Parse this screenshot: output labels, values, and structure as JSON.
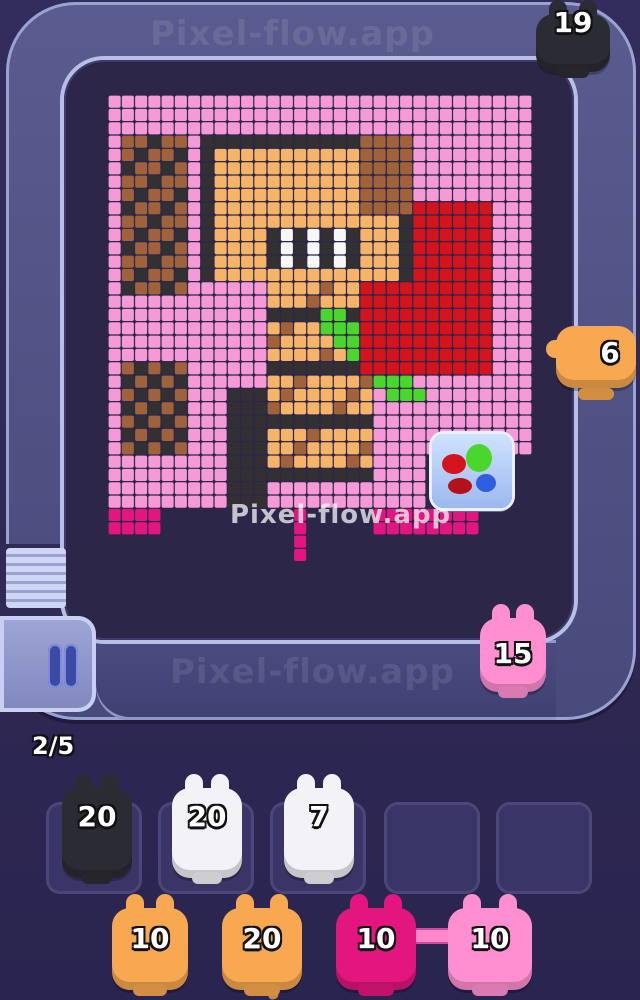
{
  "watermark": "Pixel-flow.app",
  "progress": "2/5",
  "conveyor_pigs": [
    {
      "id": "top-right",
      "count": "19",
      "color": "#2b2b33"
    },
    {
      "id": "right",
      "count": "6",
      "color": "#f7a850"
    },
    {
      "id": "bottom-right",
      "count": "15",
      "color": "#ff8fd0"
    }
  ],
  "slot_pigs": [
    {
      "count": "20",
      "color": "#2b2b33"
    },
    {
      "count": "20",
      "color": "#f2f2f7"
    },
    {
      "count": "7",
      "color": "#f2f2f7"
    }
  ],
  "queue_pigs": [
    {
      "count": "10",
      "color": "#f7a850"
    },
    {
      "count": "20",
      "color": "#f7a850"
    },
    {
      "count": "10",
      "color": "#e3157f"
    },
    {
      "count": "10",
      "color": "#ff8fd0"
    }
  ],
  "colors": {
    "pink": "#f59ad6",
    "dark": "#333033",
    "tan": "#f6b469",
    "brown": "#a0623a",
    "red": "#d4141c",
    "green": "#4ad62c",
    "white": "#f7f7f7",
    "magenta": "#e3157f",
    "track": "#4a4b80"
  }
}
